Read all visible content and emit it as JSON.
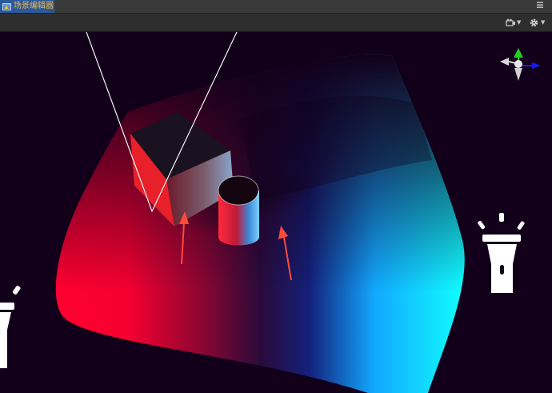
{
  "window": {
    "tab_label": "场景编辑器",
    "menu_icon": "hamburger-menu-icon"
  },
  "toolbar": {
    "camera_icon": "camera-icon",
    "settings_icon": "gear-icon"
  },
  "scene": {
    "objects": [
      "spotlight-cone",
      "cube",
      "cylinder",
      "flashlight-gizmo-right",
      "flashlight-gizmo-left",
      "direction-arrow-left",
      "direction-arrow-right",
      "orientation-gizmo"
    ],
    "colors": {
      "background": "#12001a",
      "red_light": "#ff0030",
      "cyan_light": "#10ffff",
      "arrow": "#ff4a3a",
      "gizmo_y": "#22cc22",
      "gizmo_x": "#1a1aee"
    }
  }
}
